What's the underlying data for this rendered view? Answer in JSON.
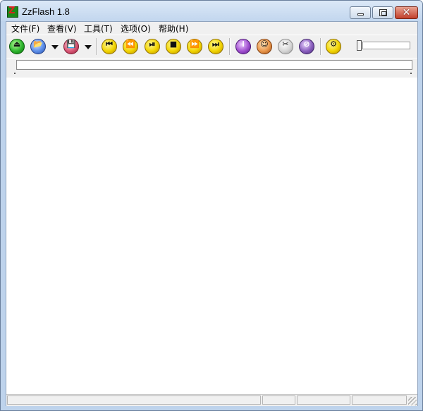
{
  "window": {
    "title": "ZzFlash 1.8",
    "icon_label": "Z",
    "close_glyph": "✕"
  },
  "menu": {
    "items": [
      {
        "label": "文件(F)"
      },
      {
        "label": "查看(V)"
      },
      {
        "label": "工具(T)"
      },
      {
        "label": "选项(O)"
      },
      {
        "label": "帮助(H)"
      }
    ]
  },
  "toolbar": {
    "buttons": [
      {
        "icon": "eject-icon",
        "glyph": "⏏"
      },
      {
        "icon": "open-folder-icon",
        "glyph": "📂"
      },
      {
        "icon": "save-disk-icon",
        "glyph": "💾"
      },
      {
        "icon": "skip-to-start-icon",
        "glyph": "⏮"
      },
      {
        "icon": "rewind-icon",
        "glyph": "⏪"
      },
      {
        "icon": "play-pause-icon",
        "glyph": "⏯"
      },
      {
        "icon": "stop-icon",
        "glyph": "■"
      },
      {
        "icon": "fast-forward-icon",
        "glyph": "⏩"
      },
      {
        "icon": "skip-to-end-icon",
        "glyph": "⏭"
      },
      {
        "icon": "info-icon",
        "glyph": "i"
      },
      {
        "icon": "face-icon",
        "glyph": "☺"
      },
      {
        "icon": "capture-icon",
        "glyph": "✂"
      },
      {
        "icon": "mask-icon",
        "glyph": "⊘"
      },
      {
        "icon": "scan-icon",
        "glyph": "⚙"
      }
    ],
    "volume": {
      "level": 0
    }
  },
  "statusbar": {
    "panes": [
      "",
      "",
      "",
      ""
    ]
  },
  "colors": {
    "frame": "#bed3ec",
    "client_bg": "#ffffff",
    "chrome_bg": "#f0f0f0"
  }
}
